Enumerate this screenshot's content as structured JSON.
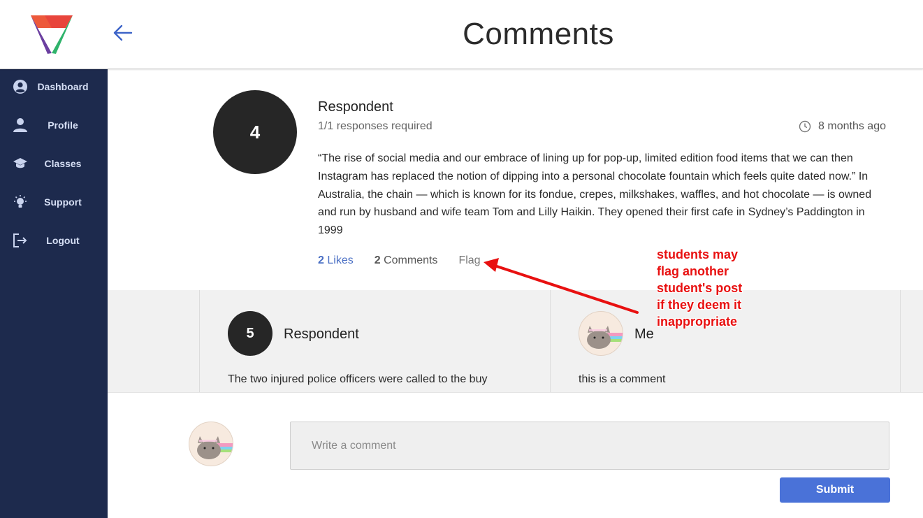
{
  "header": {
    "title": "Comments",
    "logo_icon": "triangle-v-logo",
    "back_icon": "arrow-left-icon",
    "accent_color": "#4a6fc4"
  },
  "sidebar": {
    "background": "#1d2a4d",
    "items": [
      {
        "label": "Dashboard",
        "icon": "user-circle-icon"
      },
      {
        "label": "Profile",
        "icon": "person-icon"
      },
      {
        "label": "Classes",
        "icon": "graduation-cap-icon"
      },
      {
        "label": "Support",
        "icon": "lightbulb-icon"
      },
      {
        "label": "Logout",
        "icon": "logout-icon"
      }
    ]
  },
  "post": {
    "avatar_number": "4",
    "author": "Respondent",
    "subtitle": "1/1 responses required",
    "time": "8 months ago",
    "body": "“The rise of social media and our embrace of lining up for pop-up, limited edition food items that we can then Instagram has replaced the notion of dipping into a personal chocolate fountain which feels quite dated now.” In Australia, the chain — which is known for its fondue, crepes, milkshakes, waffles, and hot chocolate — is owned and run by husband and wife team Tom and Lilly Haikin. They opened their first cafe in Sydney’s Paddington in 1999",
    "likes_count": "2",
    "likes_label": "Likes",
    "comments_count": "2",
    "comments_label": "Comments",
    "flag_label": "Flag"
  },
  "comments": [
    {
      "avatar_number": "5",
      "author": "Respondent",
      "text": "The two injured police officers were called to the buy"
    },
    {
      "avatar": "cat-avatar",
      "author": "Me",
      "text": "this is a comment"
    }
  ],
  "compose": {
    "placeholder": "Write a comment",
    "value": "",
    "submit_label": "Submit",
    "submit_color": "#4a72d8"
  },
  "annotation": {
    "lines": [
      "students may",
      "flag another",
      "student's post",
      "if they deem it",
      "inappropriate"
    ],
    "color": "#e81010"
  }
}
